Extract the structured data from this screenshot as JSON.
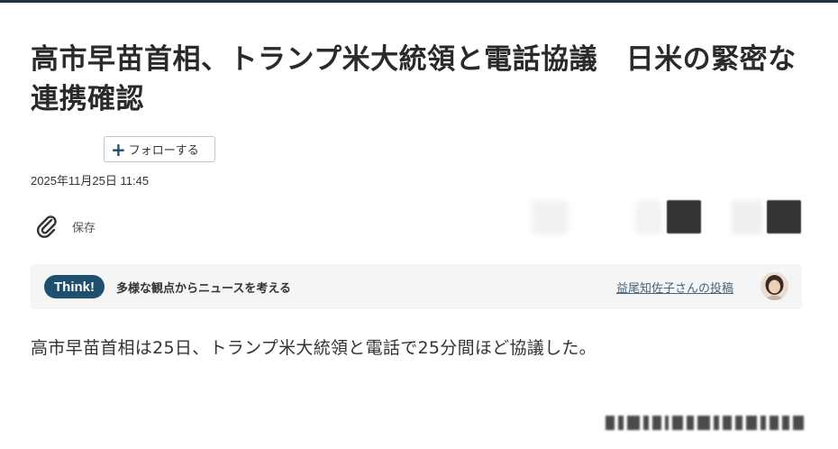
{
  "article": {
    "headline": "高市早苗首相、トランプ米大統領と電話協議　日米の緊密な連携確認",
    "follow_label": "フォローする",
    "date": "2025年11月25日 11:45",
    "save_label": "保存",
    "think": {
      "badge": "Think!",
      "caption": "多様な観点からニュースを考える",
      "author_link": "益尾知佐子さんの投稿"
    },
    "lead": "高市早苗首相は25日、トランプ米大統領と電話で25分間ほど協議した。"
  },
  "colors": {
    "brand_navy": "#1d4f6e",
    "link": "#44657f",
    "panel": "#f5f5f5"
  },
  "icons": [
    "plus-icon",
    "paperclip-icon",
    "avatar"
  ]
}
